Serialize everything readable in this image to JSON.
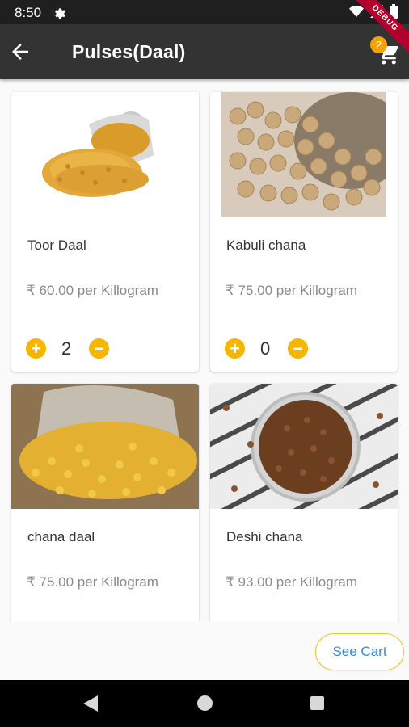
{
  "status_bar": {
    "time": "8:50"
  },
  "app_bar": {
    "title": "Pulses(Daal)",
    "cart_count": "2",
    "debug_label": "DEBUG"
  },
  "products": [
    {
      "name": "Toor Daal",
      "price": "₹ 60.00 per Killogram",
      "quantity": "2"
    },
    {
      "name": "Kabuli chana",
      "price": "₹ 75.00 per Killogram",
      "quantity": "0"
    },
    {
      "name": "chana daal",
      "price": "₹ 75.00 per Killogram"
    },
    {
      "name": "Deshi chana",
      "price": "₹ 93.00 per Killogram"
    }
  ],
  "see_cart": {
    "label": "See Cart"
  },
  "colors": {
    "app_bar": "#333333",
    "accent": "#f5b500",
    "badge": "#f4a300",
    "link": "#2f8fd6"
  }
}
